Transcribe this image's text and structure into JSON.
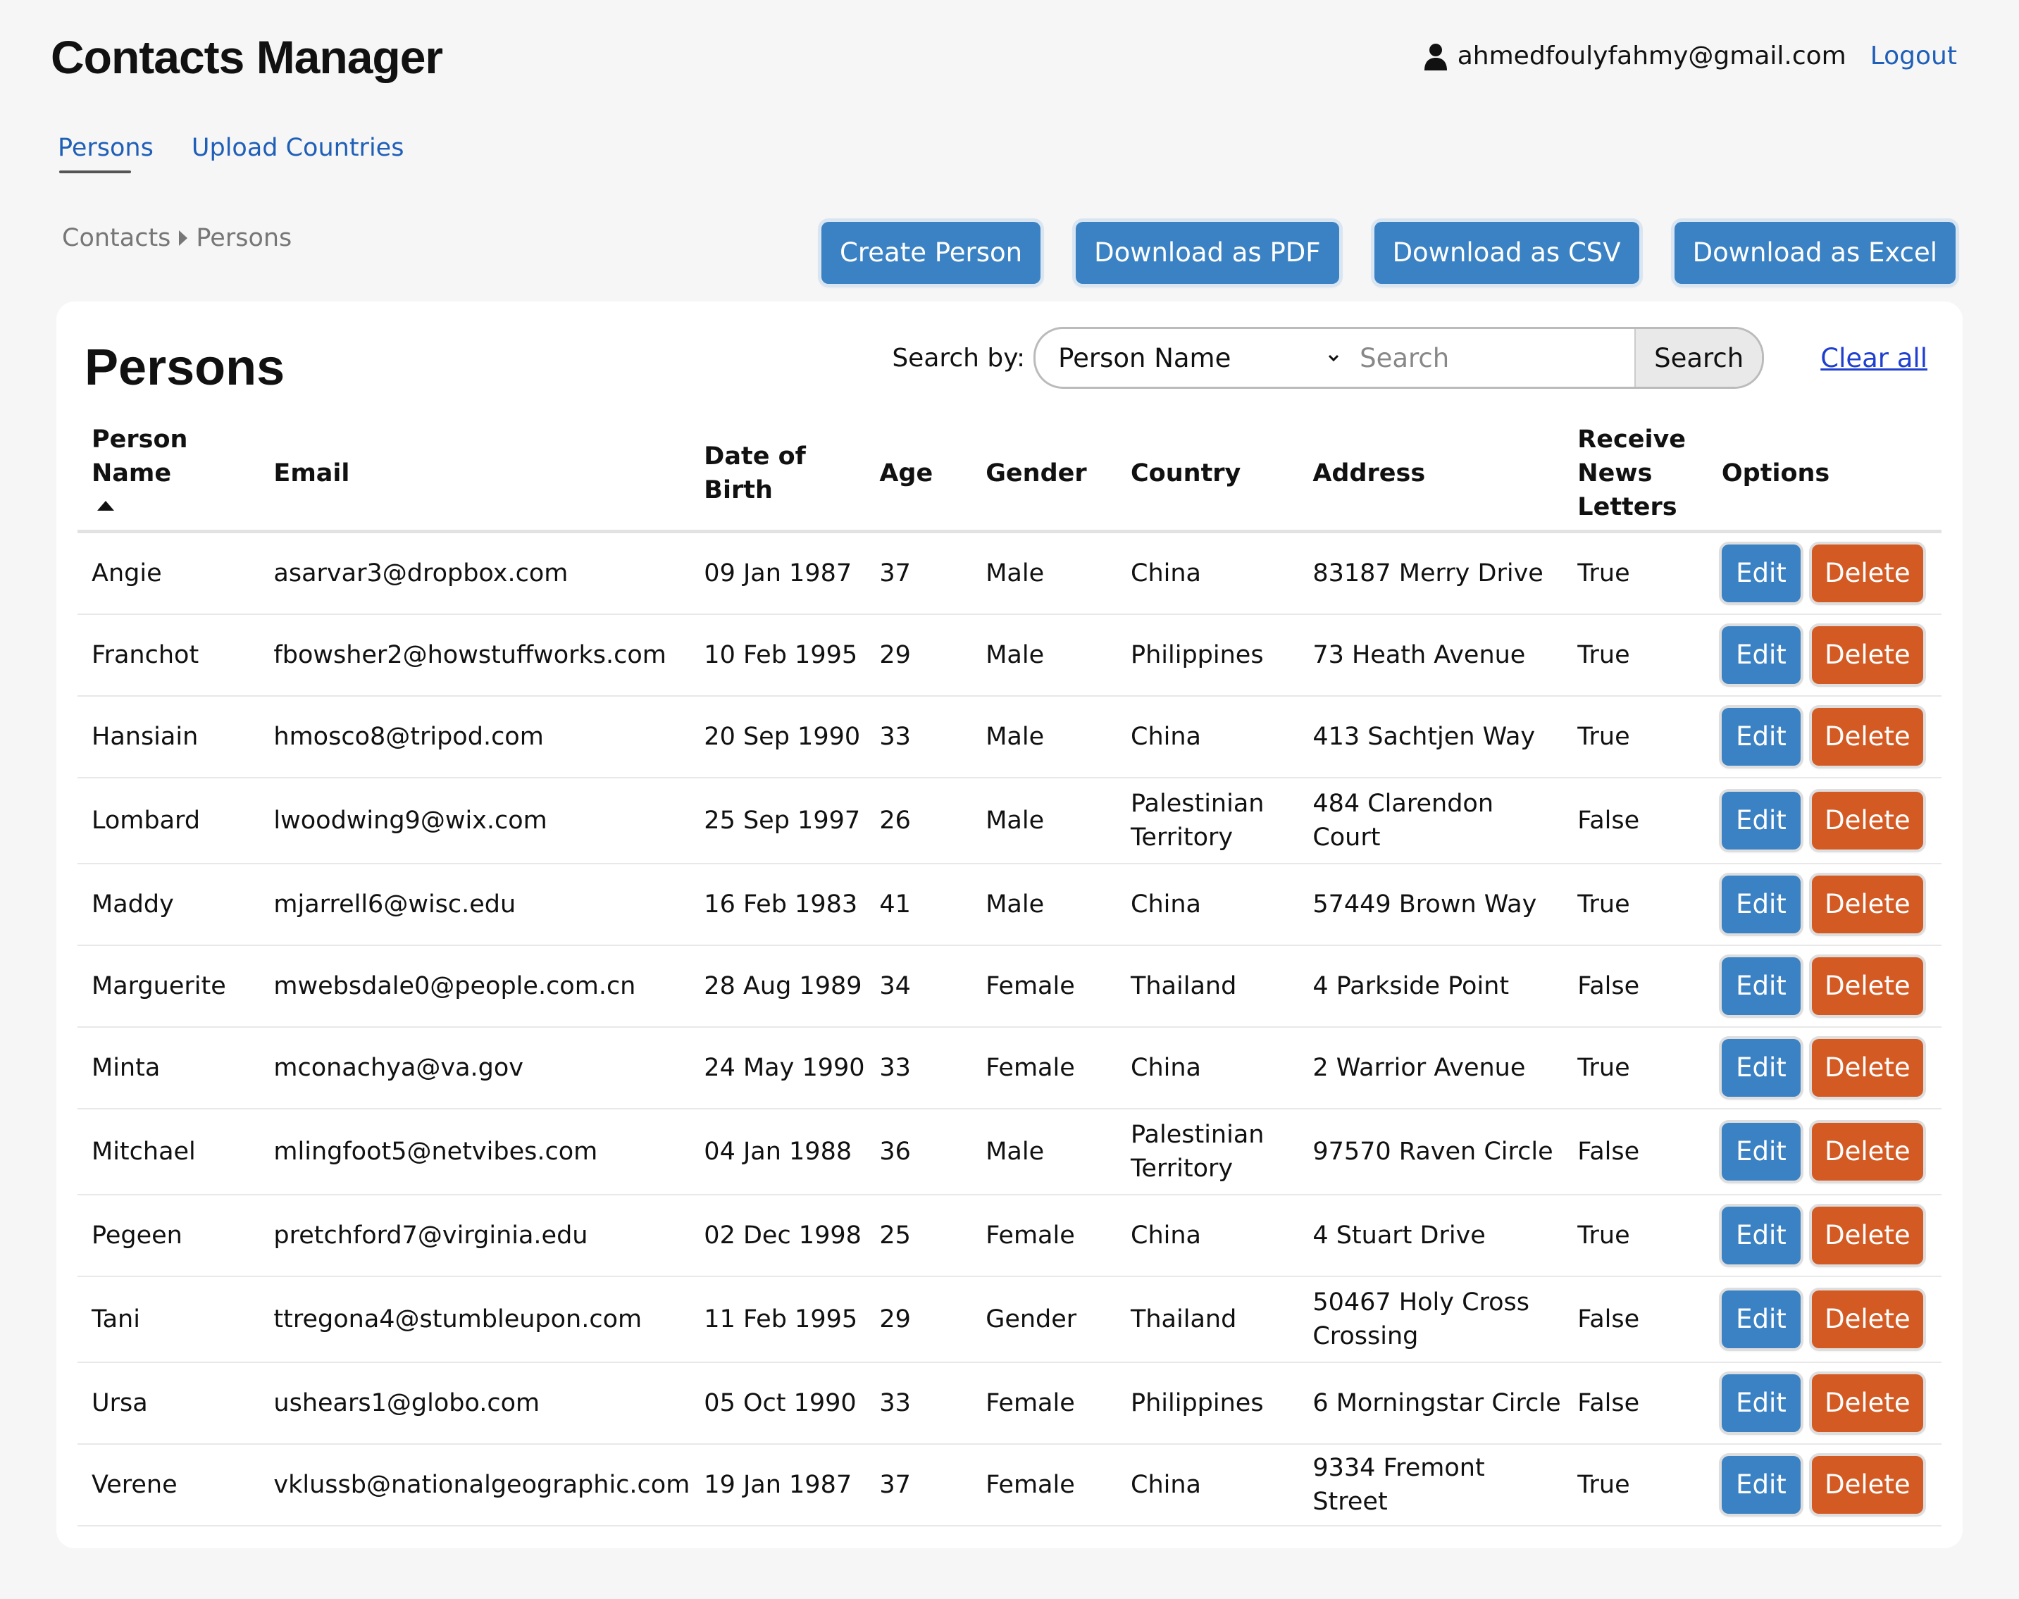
{
  "app": {
    "title": "Contacts Manager",
    "user_email": "ahmedfoulyfahmy@gmail.com",
    "logout_label": "Logout"
  },
  "nav": {
    "tabs": [
      {
        "label": "Persons",
        "active": true
      },
      {
        "label": "Upload Countries",
        "active": false
      }
    ]
  },
  "breadcrumb": [
    "Contacts",
    "Persons"
  ],
  "actions": {
    "create": "Create Person",
    "pdf": "Download as PDF",
    "csv": "Download as CSV",
    "excel": "Download as Excel"
  },
  "card": {
    "title": "Persons"
  },
  "search": {
    "label": "Search by:",
    "selected_field": "Person Name",
    "placeholder": "Search",
    "button_label": "Search",
    "clear_label": "Clear all"
  },
  "table": {
    "headers": {
      "name": "Person Name",
      "email": "Email",
      "dob": "Date of Birth",
      "age": "Age",
      "gender": "Gender",
      "country": "Country",
      "address": "Address",
      "news": "Receive News Letters",
      "options": "Options"
    },
    "sort": {
      "column": "name",
      "direction": "ascending"
    },
    "edit_label": "Edit",
    "delete_label": "Delete",
    "rows": [
      {
        "name": "Angie",
        "email": "asarvar3@dropbox.com",
        "dob": "09 Jan 1987",
        "age": "37",
        "gender": "Male",
        "country": "China",
        "address": "83187 Merry Drive",
        "news": "True"
      },
      {
        "name": "Franchot",
        "email": "fbowsher2@howstuffworks.com",
        "dob": "10 Feb 1995",
        "age": "29",
        "gender": "Male",
        "country": "Philippines",
        "address": "73 Heath Avenue",
        "news": "True"
      },
      {
        "name": "Hansiain",
        "email": "hmosco8@tripod.com",
        "dob": "20 Sep 1990",
        "age": "33",
        "gender": "Male",
        "country": "China",
        "address": "413 Sachtjen Way",
        "news": "True"
      },
      {
        "name": "Lombard",
        "email": "lwoodwing9@wix.com",
        "dob": "25 Sep 1997",
        "age": "26",
        "gender": "Male",
        "country": "Palestinian Territory",
        "address": "484 Clarendon Court",
        "news": "False"
      },
      {
        "name": "Maddy",
        "email": "mjarrell6@wisc.edu",
        "dob": "16 Feb 1983",
        "age": "41",
        "gender": "Male",
        "country": "China",
        "address": "57449 Brown Way",
        "news": "True"
      },
      {
        "name": "Marguerite",
        "email": "mwebsdale0@people.com.cn",
        "dob": "28 Aug 1989",
        "age": "34",
        "gender": "Female",
        "country": "Thailand",
        "address": "4 Parkside Point",
        "news": "False"
      },
      {
        "name": "Minta",
        "email": "mconachya@va.gov",
        "dob": "24 May 1990",
        "age": "33",
        "gender": "Female",
        "country": "China",
        "address": "2 Warrior Avenue",
        "news": "True"
      },
      {
        "name": "Mitchael",
        "email": "mlingfoot5@netvibes.com",
        "dob": "04 Jan 1988",
        "age": "36",
        "gender": "Male",
        "country": "Palestinian Territory",
        "address": "97570 Raven Circle",
        "news": "False"
      },
      {
        "name": "Pegeen",
        "email": "pretchford7@virginia.edu",
        "dob": "02 Dec 1998",
        "age": "25",
        "gender": "Female",
        "country": "China",
        "address": "4 Stuart Drive",
        "news": "True"
      },
      {
        "name": "Tani",
        "email": "ttregona4@stumbleupon.com",
        "dob": "11 Feb 1995",
        "age": "29",
        "gender": "Gender",
        "country": "Thailand",
        "address": "50467 Holy Cross Crossing",
        "news": "False"
      },
      {
        "name": "Ursa",
        "email": "ushears1@globo.com",
        "dob": "05 Oct 1990",
        "age": "33",
        "gender": "Female",
        "country": "Philippines",
        "address": "6 Morningstar Circle",
        "news": "False"
      },
      {
        "name": "Verene",
        "email": "vklussb@nationalgeographic.com",
        "dob": "19 Jan 1987",
        "age": "37",
        "gender": "Female",
        "country": "China",
        "address": "9334 Fremont Street",
        "news": "True"
      }
    ]
  },
  "colors": {
    "primary_button": "#3b82c4",
    "delete_button": "#d45a24",
    "link": "#1f5fb8",
    "background": "#f6f6f6"
  }
}
